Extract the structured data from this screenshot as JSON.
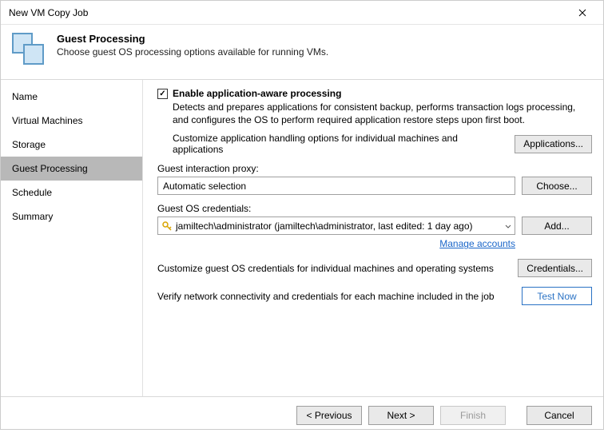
{
  "window": {
    "title": "New VM Copy Job"
  },
  "header": {
    "title": "Guest Processing",
    "subtitle": "Choose guest OS processing options available for running VMs."
  },
  "sidebar": {
    "items": [
      {
        "label": "Name"
      },
      {
        "label": "Virtual Machines"
      },
      {
        "label": "Storage"
      },
      {
        "label": "Guest Processing",
        "active": true
      },
      {
        "label": "Schedule"
      },
      {
        "label": "Summary"
      }
    ]
  },
  "main": {
    "enable_checkbox_label": "Enable application-aware processing",
    "enable_description": "Detects and prepares applications for consistent backup, performs transaction logs processing, and configures the OS to perform required application restore steps upon first boot.",
    "customize_app_text": "Customize application handling options for individual machines and applications",
    "applications_button": "Applications...",
    "proxy_label": "Guest interaction proxy:",
    "proxy_value": "Automatic selection",
    "choose_button": "Choose...",
    "creds_label": "Guest OS credentials:",
    "creds_value": "jamiltech\\administrator (jamiltech\\administrator, last edited: 1 day ago)",
    "add_button": "Add...",
    "manage_accounts_link": "Manage accounts",
    "customize_creds_text": "Customize guest OS credentials for individual machines and operating systems",
    "credentials_button": "Credentials...",
    "verify_text": "Verify network connectivity and credentials for each machine included in the job",
    "test_now_button": "Test Now"
  },
  "footer": {
    "previous": "< Previous",
    "next": "Next >",
    "finish": "Finish",
    "cancel": "Cancel"
  }
}
